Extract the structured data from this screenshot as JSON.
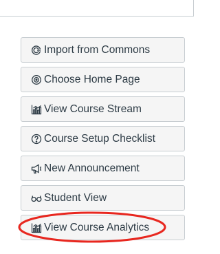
{
  "sidebar": {
    "buttons": [
      {
        "label": "Import from Commons",
        "icon": "commons-icon"
      },
      {
        "label": "Choose Home Page",
        "icon": "target-icon"
      },
      {
        "label": "View Course Stream",
        "icon": "analytics-icon"
      },
      {
        "label": "Course Setup Checklist",
        "icon": "question-icon"
      },
      {
        "label": "New Announcement",
        "icon": "megaphone-icon"
      },
      {
        "label": "Student View",
        "icon": "glasses-icon"
      },
      {
        "label": "View Course Analytics",
        "icon": "analytics-icon"
      }
    ]
  },
  "highlight": {
    "color": "#e8271f",
    "target": "View Course Analytics"
  },
  "colors": {
    "button_bg": "#f5f5f5",
    "button_border": "#c7cdd1",
    "text": "#2d3b45"
  }
}
